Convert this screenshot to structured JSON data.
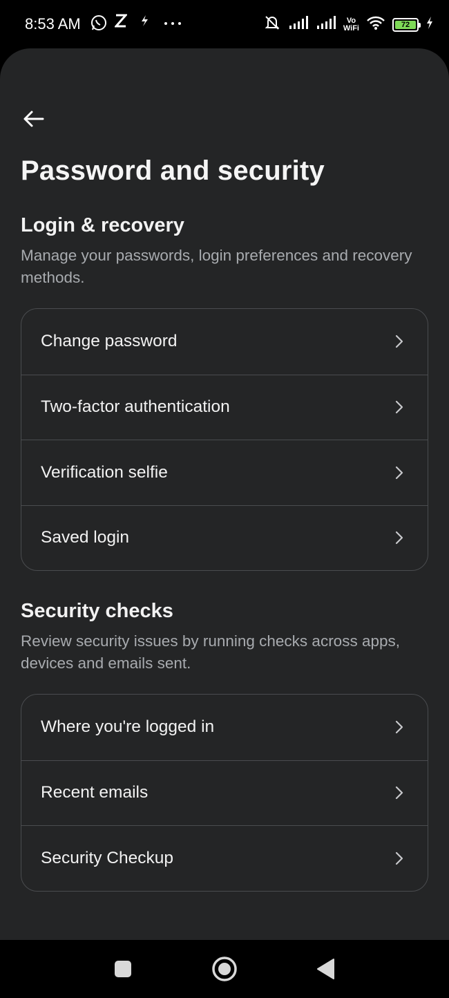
{
  "status_bar": {
    "time": "8:53 AM",
    "left_icons": [
      "whatsapp-icon",
      "z-icon",
      "flash-icon",
      "more-icon"
    ],
    "right_icons": [
      "silent-bell-icon",
      "signal-icon",
      "signal-icon",
      "vowifi-icon",
      "wifi-icon",
      "battery-icon",
      "charging-icon"
    ],
    "vowifi_top": "Vo",
    "vowifi_bottom": "WiFi",
    "battery_level": "72",
    "battery_color": "#7ed957"
  },
  "header": {
    "back_icon": "arrow-left-icon",
    "title": "Password and security"
  },
  "login_recovery": {
    "title": "Login & recovery",
    "description": "Manage your passwords, login preferences and recovery methods.",
    "items": [
      {
        "label": "Change password"
      },
      {
        "label": "Two-factor authentication"
      },
      {
        "label": "Verification selfie"
      },
      {
        "label": "Saved login"
      }
    ]
  },
  "security_checks": {
    "title": "Security checks",
    "description": "Review security issues by running checks across apps, devices and emails sent.",
    "items": [
      {
        "label": "Where you're logged in"
      },
      {
        "label": "Recent emails"
      },
      {
        "label": "Security Checkup"
      }
    ]
  },
  "nav_bar": {
    "buttons": [
      "recents-square-icon",
      "home-circle-icon",
      "back-triangle-icon"
    ]
  },
  "colors": {
    "background": "#242526",
    "border": "#4a4c4f",
    "secondary_text": "#a8abaf"
  }
}
